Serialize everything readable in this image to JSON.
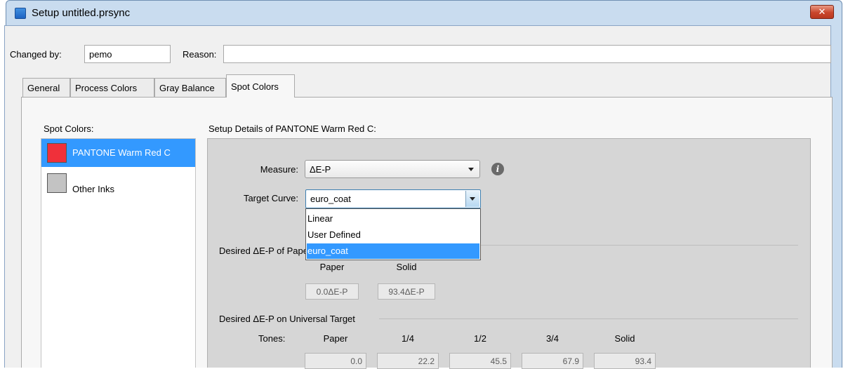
{
  "window": {
    "title": "Setup untitled.prsync",
    "close_glyph": "✕"
  },
  "header": {
    "changed_by_label": "Changed by:",
    "changed_by_value": "pemo",
    "reason_label": "Reason:",
    "reason_value": ""
  },
  "tabs": [
    {
      "label": "General",
      "active": false
    },
    {
      "label": "Process Colors",
      "active": false
    },
    {
      "label": "Gray Balance",
      "active": false
    },
    {
      "label": "Spot Colors",
      "active": true
    }
  ],
  "spot_colors": {
    "label": "Spot Colors:",
    "items": [
      {
        "name": "PANTONE Warm Red C",
        "swatch_color": "#f0303a",
        "selected": true
      },
      {
        "name": "Other Inks",
        "swatch_color": "#c3c3c3",
        "selected": false
      }
    ]
  },
  "details": {
    "label": "Setup Details of PANTONE Warm Red C:",
    "measure_label": "Measure:",
    "measure_value": "ΔE-P",
    "target_curve_label": "Target Curve:",
    "target_curve_value": "euro_coat",
    "target_curve_options": [
      "Linear",
      "User Defined",
      "euro_coat"
    ],
    "target_curve_selected_index": 2,
    "info_icon": "info-icon",
    "info_glyph": "i"
  },
  "paper_solid": {
    "group_title": "Desired ΔE-P of Paper and Solid",
    "paper_label": "Paper",
    "solid_label": "Solid",
    "paper_value": "0.0ΔE-P",
    "solid_value": "93.4ΔE-P"
  },
  "universal": {
    "group_title": "Desired ΔE-P on Universal Target",
    "tones_label": "Tones:",
    "columns": [
      "Paper",
      "1/4",
      "1/2",
      "3/4",
      "Solid"
    ],
    "values": [
      "0.0",
      "22.2",
      "45.5",
      "67.9",
      "93.4"
    ]
  },
  "colors": {
    "selection": "#3399ff",
    "details_panel": "#d6d6d6",
    "titlebar": "#c9dcef"
  }
}
